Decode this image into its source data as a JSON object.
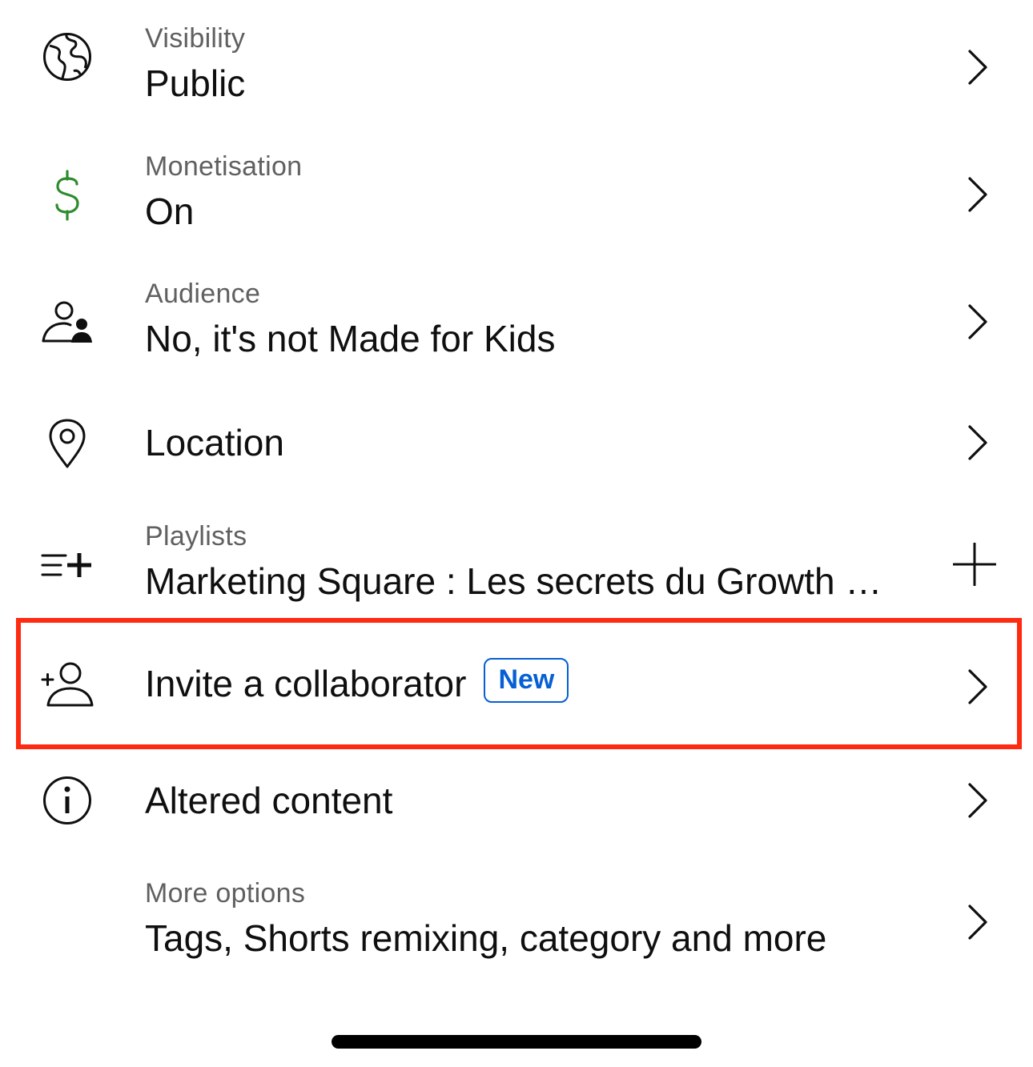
{
  "rows": [
    {
      "icon": "globe-icon",
      "label": "Visibility",
      "value": "Public",
      "action": "chevron-right-icon"
    },
    {
      "icon": "dollar-icon",
      "label": "Monetisation",
      "value": "On",
      "action": "chevron-right-icon"
    },
    {
      "icon": "audience-icon",
      "label": "Audience",
      "value": "No, it's not Made for Kids",
      "action": "chevron-right-icon"
    },
    {
      "icon": "location-pin-icon",
      "value": "Location",
      "action": "chevron-right-icon"
    },
    {
      "icon": "playlist-add-icon",
      "label": "Playlists",
      "value": "Marketing Square : Les secrets du Growth Hacking",
      "action": "plus-icon"
    },
    {
      "icon": "add-person-icon",
      "value": "Invite a collaborator",
      "badge": "New",
      "action": "chevron-right-icon"
    },
    {
      "icon": "info-icon",
      "value": "Altered content",
      "action": "chevron-right-icon"
    },
    {
      "label": "More options",
      "value": "Tags, Shorts remixing, category and more",
      "action": "chevron-right-icon"
    }
  ],
  "colors": {
    "monetisation_icon": "#2e8b2e",
    "badge": "#065fd4",
    "highlight": "#ff2a12",
    "label": "#606060",
    "text": "#0f0f0f"
  }
}
